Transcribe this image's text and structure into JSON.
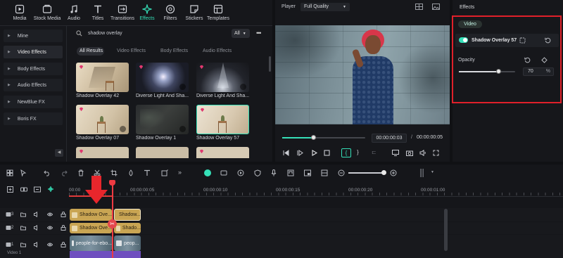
{
  "toolbar": {
    "items": [
      {
        "label": "Media",
        "icon": "media-icon"
      },
      {
        "label": "Stock Media",
        "icon": "stock-media-icon"
      },
      {
        "label": "Audio",
        "icon": "audio-icon"
      },
      {
        "label": "Titles",
        "icon": "titles-icon"
      },
      {
        "label": "Transitions",
        "icon": "transitions-icon"
      },
      {
        "label": "Effects",
        "icon": "effects-icon"
      },
      {
        "label": "Filters",
        "icon": "filters-icon"
      },
      {
        "label": "Stickers",
        "icon": "stickers-icon"
      },
      {
        "label": "Templates",
        "icon": "templates-icon"
      }
    ]
  },
  "sidebar": {
    "items": [
      {
        "label": "Mine"
      },
      {
        "label": "Video Effects"
      },
      {
        "label": "Body Effects"
      },
      {
        "label": "Audio Effects"
      },
      {
        "label": "NewBlue FX"
      },
      {
        "label": "Boris FX"
      }
    ]
  },
  "search": {
    "value": "shadow overlay",
    "filter": "All"
  },
  "tabs": [
    "All Results",
    "Video Effects",
    "Body Effects",
    "Audio Effects"
  ],
  "effects": [
    {
      "label": "Shadow Overlay 42"
    },
    {
      "label": "Diverse Light And Sha..."
    },
    {
      "label": "Diverse Light And Sha..."
    },
    {
      "label": "Shadow Overlay 07"
    },
    {
      "label": "Shadow Overlay 1"
    },
    {
      "label": "Shadow Overlay 57"
    }
  ],
  "player": {
    "label": "Player",
    "quality": "Full Quality",
    "current_time": "00:00:00:03",
    "separator": "/",
    "total_time": "00:00:00:05",
    "progress": 0.38
  },
  "properties": {
    "panel_title": "Effects",
    "tab": "Video",
    "effect_name": "Shadow Overlay 57",
    "opacity_label": "Opacity",
    "opacity_value": "70",
    "opacity_unit": "%",
    "opacity_fraction": 0.7
  },
  "timeline": {
    "ruler": [
      "00:00",
      "00:00:00:05",
      "00:00:00:10",
      "00:00:00:15",
      "00:00:00:20",
      "00:00:01:00"
    ],
    "tracks": [
      {
        "number": "3"
      },
      {
        "number": "2"
      },
      {
        "number": "1",
        "name": "Video 1"
      }
    ],
    "clips": {
      "track3_a": "Shadow Ove...",
      "track3_b": "Shadow...",
      "track2_a": "Shadow Ove...",
      "track2_b": "Shado...",
      "track1_a": "people-for-ebo...",
      "track1_b": "peop..."
    }
  },
  "colors": {
    "accent": "#35e0b8",
    "highlight_box": "#e0202a",
    "arrow": "#e8262c",
    "clip_gold": "#c9a553"
  }
}
